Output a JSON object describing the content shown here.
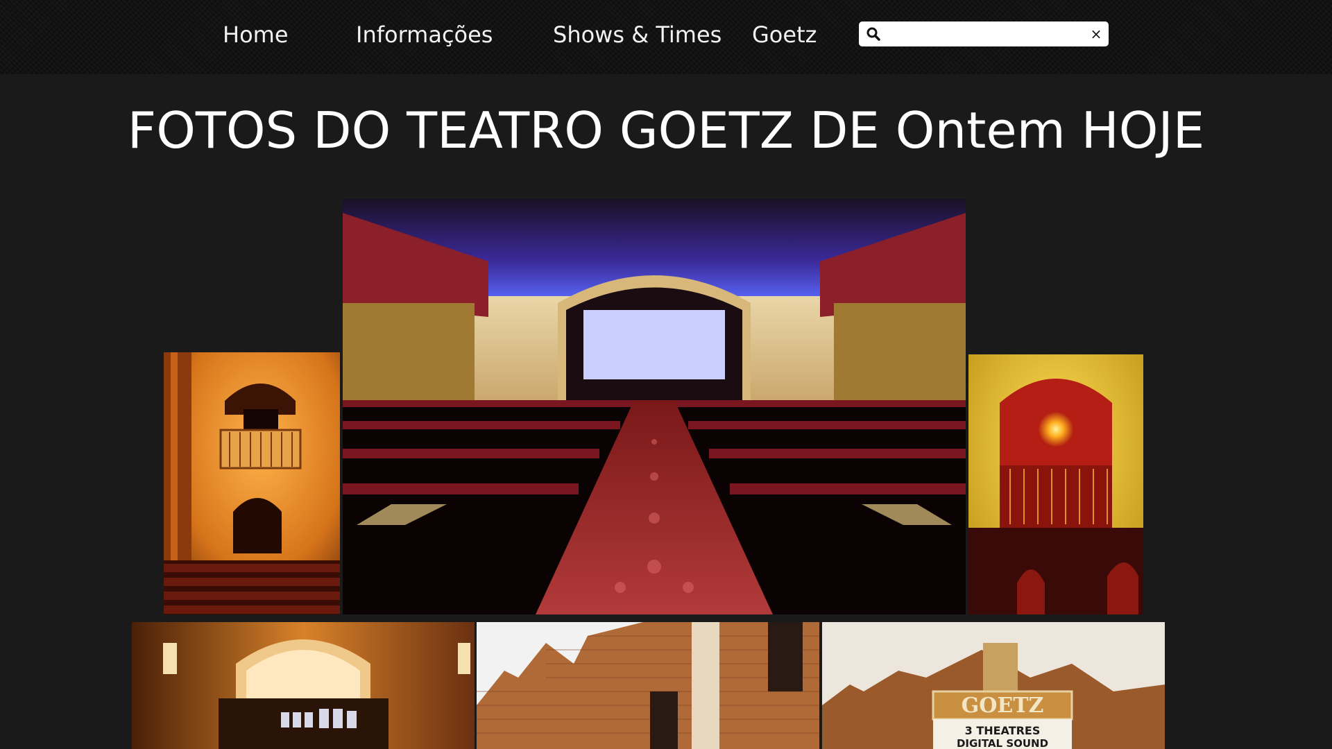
{
  "nav": {
    "items": [
      {
        "label": "Home"
      },
      {
        "label": "Informações"
      },
      {
        "label": "Shows & Times"
      },
      {
        "label": "Goetz"
      }
    ],
    "search": {
      "value": "",
      "placeholder": ""
    },
    "search_icon": "search-icon",
    "clear_icon": "close-icon",
    "clear_label": "×"
  },
  "page": {
    "title": "FOTOS DO TEATRO GOETZ DE Ontem HOJE"
  },
  "gallery": {
    "photos": [
      {
        "subject": "theater-box-balcony-photo",
        "marquee_text": ""
      },
      {
        "subject": "auditorium-screen-photo",
        "marquee_text": ""
      },
      {
        "subject": "wall-sconce-niche-photo",
        "marquee_text": ""
      },
      {
        "subject": "concession-stand-photo",
        "marquee_text": ""
      },
      {
        "subject": "brick-facade-photo",
        "marquee_text": ""
      },
      {
        "subject": "goetz-marquee-photo",
        "marquee_text": "GOETZ"
      }
    ],
    "marquee_line1": "3 THEATRES",
    "marquee_line2": "DIGITAL SOUND"
  },
  "colors": {
    "background": "#1a1a1a",
    "navbar": "#121212",
    "text": "#ffffff"
  }
}
